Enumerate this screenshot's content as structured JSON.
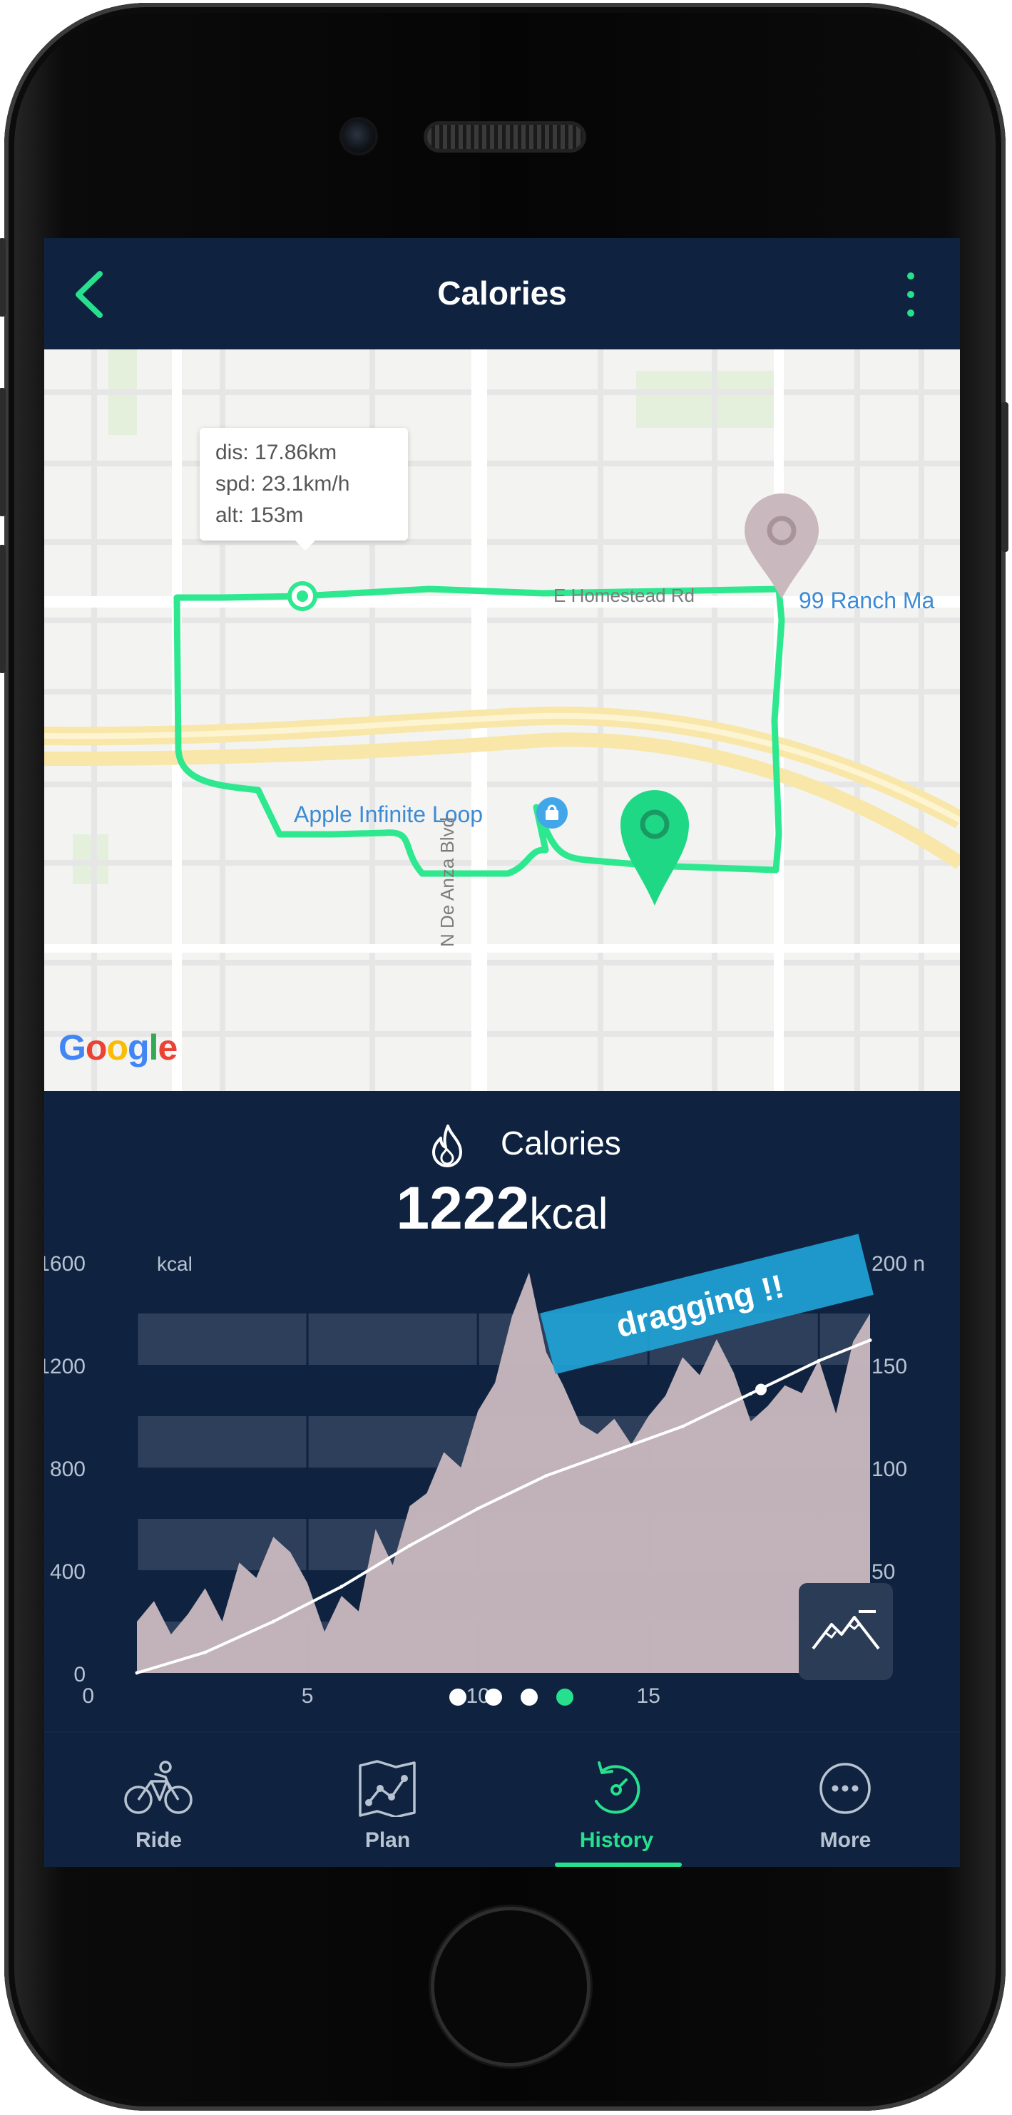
{
  "header": {
    "title": "Calories"
  },
  "map": {
    "tooltip": {
      "dis": "dis: 17.86km",
      "spd": "spd: 23.1km/h",
      "alt": "alt: 153m"
    },
    "labels": {
      "road": "E Homestead Rd",
      "place_poi": "99 Ranch Ma",
      "apple": "Apple Infinite Loop",
      "avenue": "N De Anza Blvd"
    },
    "google": "Google",
    "route_color": "#2ee88f"
  },
  "calories": {
    "label": "Calories",
    "value": "1222",
    "unit": "kcal",
    "dragging_badge": "dragging !!"
  },
  "chart_data": {
    "type": "area",
    "ylabel": "kcal",
    "y_ticks": [
      "0",
      "400",
      "800",
      "1200",
      "1600"
    ],
    "ylim": [
      0,
      1600
    ],
    "y2_ticks": [
      "50",
      "100",
      "150",
      "200 n"
    ],
    "y2lim": [
      0,
      200
    ],
    "x_ticks": [
      "5",
      "10",
      "15"
    ],
    "xlim": [
      0,
      21.5
    ],
    "series": [
      {
        "x": [
          0,
          0.5,
          1,
          1.5,
          2,
          2.5,
          3,
          3.5,
          4,
          4.5,
          5,
          5.5,
          6,
          6.5,
          7,
          7.5,
          8,
          8.5,
          9,
          9.5,
          10,
          10.5,
          11,
          11.5,
          12,
          12.5,
          13,
          13.5,
          14,
          14.5,
          15,
          15.5,
          16,
          16.5,
          17,
          17.5,
          18,
          18.5,
          19,
          19.5,
          20,
          20.5,
          21,
          21.5
        ],
        "values": [
          200,
          280,
          150,
          230,
          330,
          200,
          430,
          370,
          530,
          470,
          350,
          160,
          300,
          240,
          560,
          420,
          650,
          700,
          860,
          800,
          1020,
          1130,
          1390,
          1560,
          1250,
          1120,
          970,
          930,
          990,
          890,
          1000,
          1080,
          1230,
          1160,
          1300,
          1170,
          980,
          1040,
          1120,
          1090,
          1220,
          1010,
          1290,
          1400
        ]
      },
      {
        "x": [
          0,
          2,
          4,
          6,
          8,
          10,
          12,
          14,
          16,
          18,
          20,
          21.5
        ],
        "values": [
          0,
          10,
          25,
          42,
          62,
          80,
          96,
          108,
          120,
          136,
          152,
          162
        ]
      }
    ],
    "grid": "horizontal bands"
  },
  "pager": {
    "total": 4,
    "active": 4
  },
  "tabs": [
    {
      "label": "Ride",
      "icon": "bicycle-icon"
    },
    {
      "label": "Plan",
      "icon": "map-route-icon"
    },
    {
      "label": "History",
      "icon": "history-icon"
    },
    {
      "label": "More",
      "icon": "more-icon"
    }
  ],
  "colors": {
    "accent": "#26e08e",
    "panel": "#0f2340",
    "area": "#c5b6bc"
  }
}
